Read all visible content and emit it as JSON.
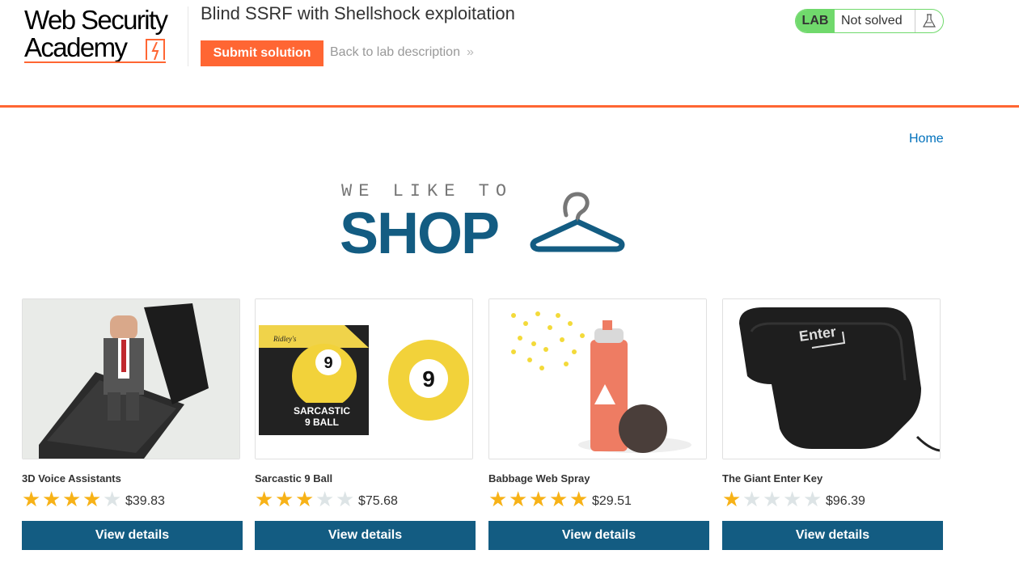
{
  "header": {
    "logo_line1": "Web Security",
    "logo_line2": "Academy",
    "lab_title": "Blind SSRF with Shellshock exploitation",
    "submit_label": "Submit solution",
    "back_label": "Back to lab description",
    "status_tag": "LAB",
    "status_text": "Not solved"
  },
  "nav": {
    "home": "Home"
  },
  "banner": {
    "sub": "WE LIKE TO",
    "main": "SHOP"
  },
  "products": [
    {
      "name": "3D Voice Assistants",
      "rating": 4,
      "price": "$39.83",
      "button": "View details"
    },
    {
      "name": "Sarcastic 9 Ball",
      "rating": 3,
      "price": "$75.68",
      "button": "View details"
    },
    {
      "name": "Babbage Web Spray",
      "rating": 5,
      "price": "$29.51",
      "button": "View details"
    },
    {
      "name": "The Giant Enter Key",
      "rating": 1,
      "price": "$96.39",
      "button": "View details"
    }
  ],
  "product_image_texts": {
    "ball_box_brand": "Ridley's",
    "ball_box_title": "SARCASTIC",
    "ball_box_title2": "9 BALL",
    "ball_number": "9",
    "key_label": "Enter"
  },
  "colors": {
    "accent": "#ff6633",
    "primary": "#135c82",
    "star": "#f7b217",
    "solved_green": "#70d96c"
  }
}
